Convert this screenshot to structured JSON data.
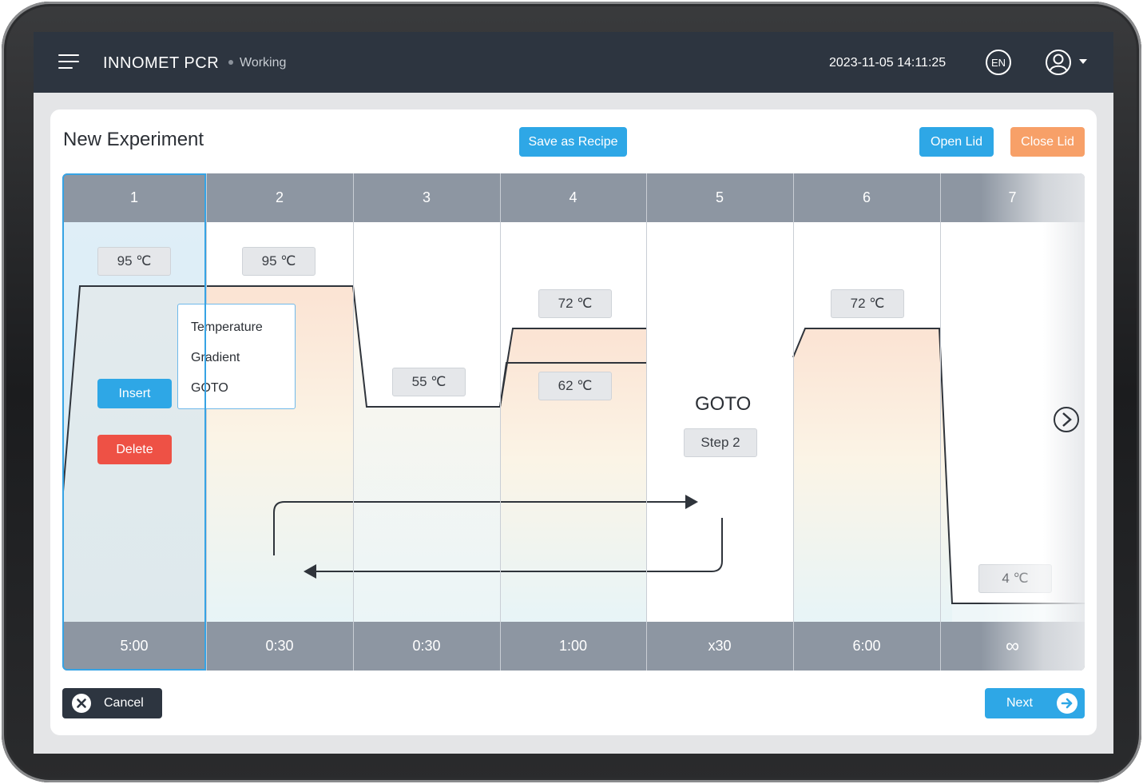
{
  "header": {
    "app_title": "INNOMET PCR",
    "status": "Working",
    "datetime": "2023-11-05 14:11:25",
    "language": "EN"
  },
  "page": {
    "title": "New Experiment",
    "save_recipe_label": "Save as Recipe",
    "open_lid_label": "Open Lid",
    "close_lid_label": "Close Lid"
  },
  "steps": [
    {
      "number": "1",
      "time": "5:00"
    },
    {
      "number": "2",
      "time": "0:30"
    },
    {
      "number": "3",
      "time": "0:30"
    },
    {
      "number": "4",
      "time": "1:00"
    },
    {
      "number": "5",
      "time": "x30"
    },
    {
      "number": "6",
      "time": "6:00"
    },
    {
      "number": "7",
      "time": "∞"
    }
  ],
  "temps": {
    "s1": "95 ℃",
    "s2": "95 ℃",
    "s3": "55 ℃",
    "s4_high": "72 ℃",
    "s4_low": "62 ℃",
    "s6": "72 ℃",
    "s7": "4 ℃"
  },
  "goto": {
    "title": "GOTO",
    "target": "Step 2"
  },
  "context_menu": {
    "items": [
      "Temperature",
      "Gradient",
      "GOTO"
    ]
  },
  "step_actions": {
    "insert_label": "Insert",
    "delete_label": "Delete"
  },
  "footer": {
    "cancel_label": "Cancel",
    "next_label": "Next"
  },
  "colors": {
    "header_bg": "#2d3540",
    "accent_blue": "#2ea7e6",
    "close_lid_orange": "#f7a068",
    "delete_red": "#ee5145",
    "column_header": "#8d96a2"
  }
}
